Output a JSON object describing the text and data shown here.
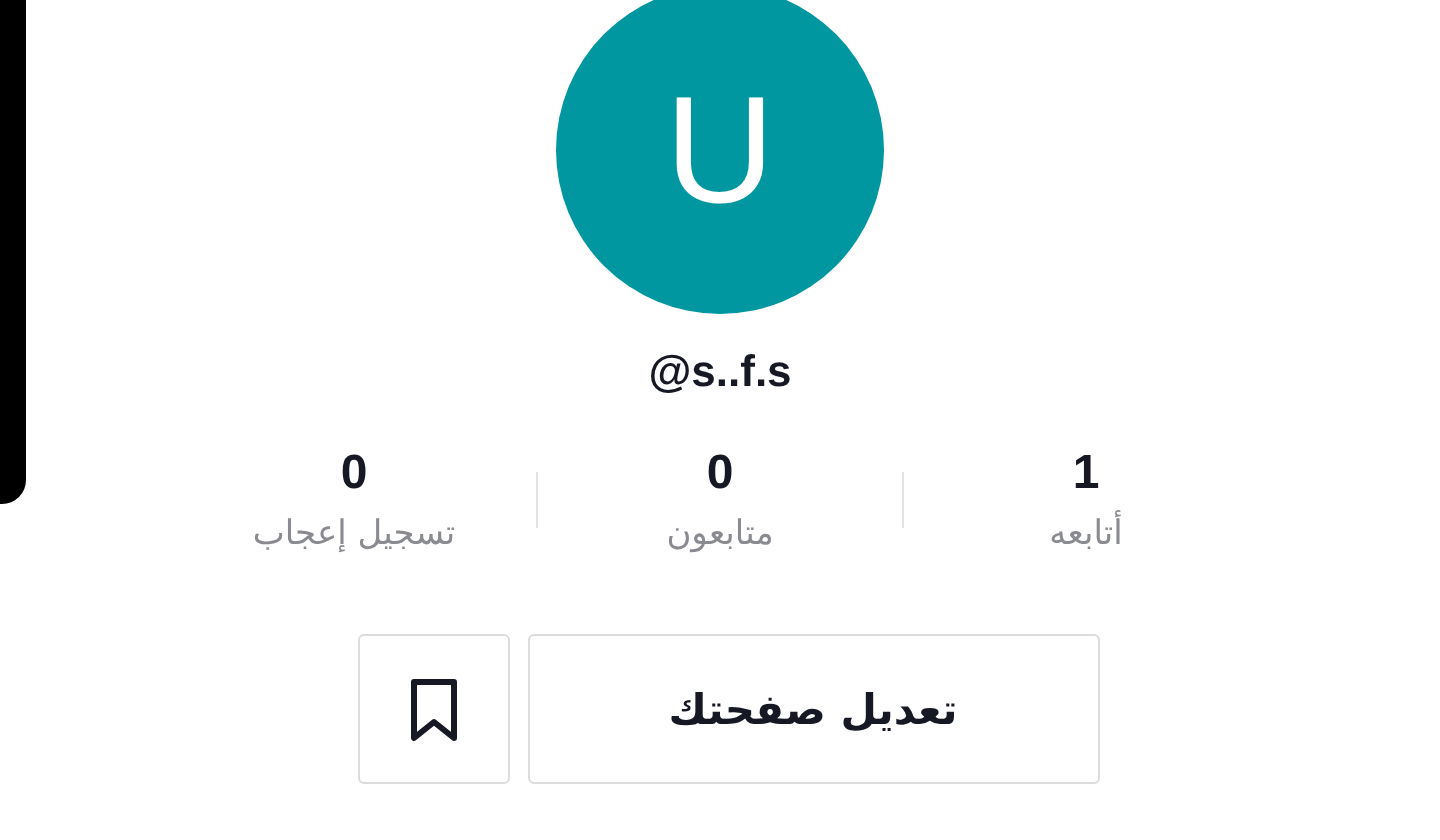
{
  "avatar": {
    "initial": "U",
    "color": "#0097a0"
  },
  "username": "@s..f.s",
  "stats": [
    {
      "value": "1",
      "label": "أتابعه"
    },
    {
      "value": "0",
      "label": "متابعون"
    },
    {
      "value": "0",
      "label": "تسجيل إعجاب"
    }
  ],
  "buttons": {
    "edit_profile": "تعديل صفحتك"
  }
}
